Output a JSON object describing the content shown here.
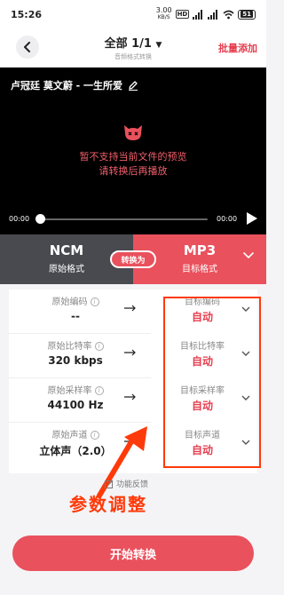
{
  "status_bar": {
    "time": "15:26",
    "net_speed": "3.00",
    "net_unit": "KB/S",
    "hd_badge": "HD",
    "battery": "51"
  },
  "header": {
    "title": "全部 1/1",
    "title_caret": "▼",
    "subtitle": "音频格式转换",
    "batch_add": "批量添加"
  },
  "player": {
    "song": "卢冠廷 莫文蔚 - 一生所爱",
    "message_line1": "暂不支持当前文件的预览",
    "message_line2": "请转换后再播放",
    "time_current": "00:00",
    "time_total": "00:00",
    "progress": 0
  },
  "formats": {
    "source_name": "NCM",
    "source_label": "原始格式",
    "convert_label": "转换为",
    "target_name": "MP3",
    "target_label": "目标格式"
  },
  "settings": [
    {
      "src_label": "原始编码",
      "src_value": "--",
      "dst_label": "目标编码",
      "dst_value": "自动"
    },
    {
      "src_label": "原始比特率",
      "src_value": "320 kbps",
      "dst_label": "目标比特率",
      "dst_value": "自动"
    },
    {
      "src_label": "原始采样率",
      "src_value": "44100 Hz",
      "dst_label": "目标采样率",
      "dst_value": "自动"
    },
    {
      "src_label": "原始声道",
      "src_value": "立体声（2.0）",
      "dst_label": "目标声道",
      "dst_value": "自动"
    }
  ],
  "feedback": "功能反馈",
  "annotation": "参数调整",
  "start_button": "开始转换",
  "colors": {
    "accent": "#e9515d",
    "annotation": "#ff3a0a",
    "dark_panel": "#484a4f"
  }
}
